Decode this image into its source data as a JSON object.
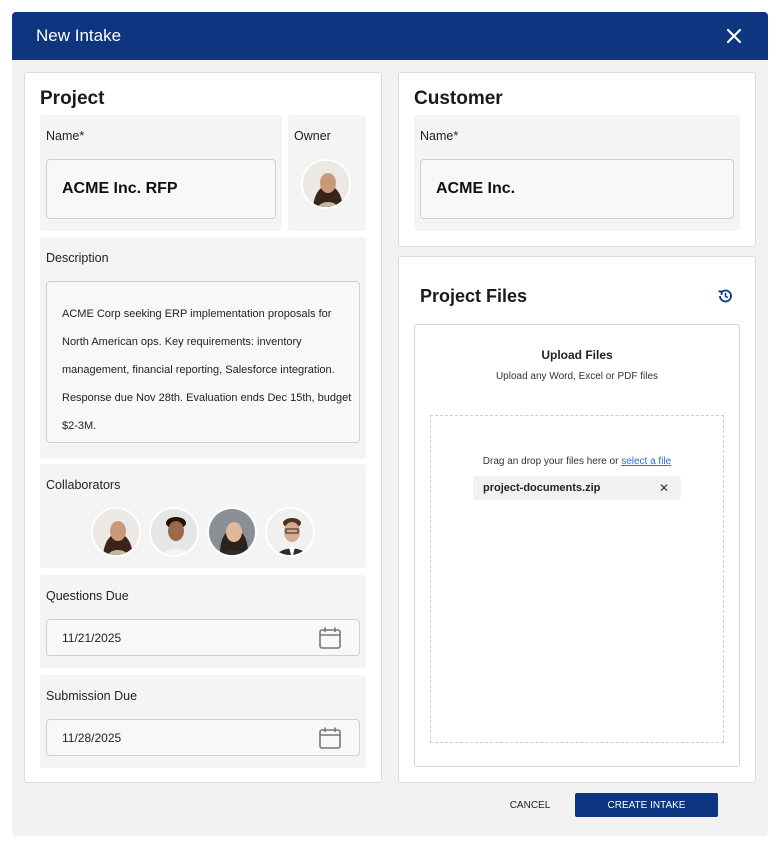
{
  "dialog": {
    "title": "New Intake"
  },
  "project": {
    "heading": "Project",
    "name_label": "Name*",
    "name_value": "ACME Inc. RFP",
    "owner_label": "Owner",
    "description_label": "Description",
    "description_text": "ACME Corp seeking ERP implementation proposals for North American ops. Key requirements: inventory management, financial reporting, Salesforce integration. Response due Nov 28th. Evaluation ends Dec 15th, budget $2-3M.",
    "collaborators_label": "Collaborators",
    "questions_due_label": "Questions Due",
    "questions_due_value": "11/21/2025",
    "submission_due_label": "Submission Due",
    "submission_due_value": "11/28/2025"
  },
  "customer": {
    "heading": "Customer",
    "name_label": "Name*",
    "name_value": "ACME Inc."
  },
  "files": {
    "heading": "Project Files",
    "upload_title": "Upload Files",
    "upload_subtitle": "Upload any Word, Excel or PDF files",
    "drag_text": "Drag an drop your files here or ",
    "select_link": "select a file",
    "file_name": "project-documents.zip"
  },
  "actions": {
    "cancel": "CANCEL",
    "create": "CREATE INTAKE"
  },
  "colors": {
    "header_bg": "#0d3580",
    "primary_button": "#0d3580",
    "link": "#2d6fd6"
  },
  "icons": [
    "close-icon",
    "history-icon",
    "calendar-icon",
    "remove-file-icon"
  ]
}
